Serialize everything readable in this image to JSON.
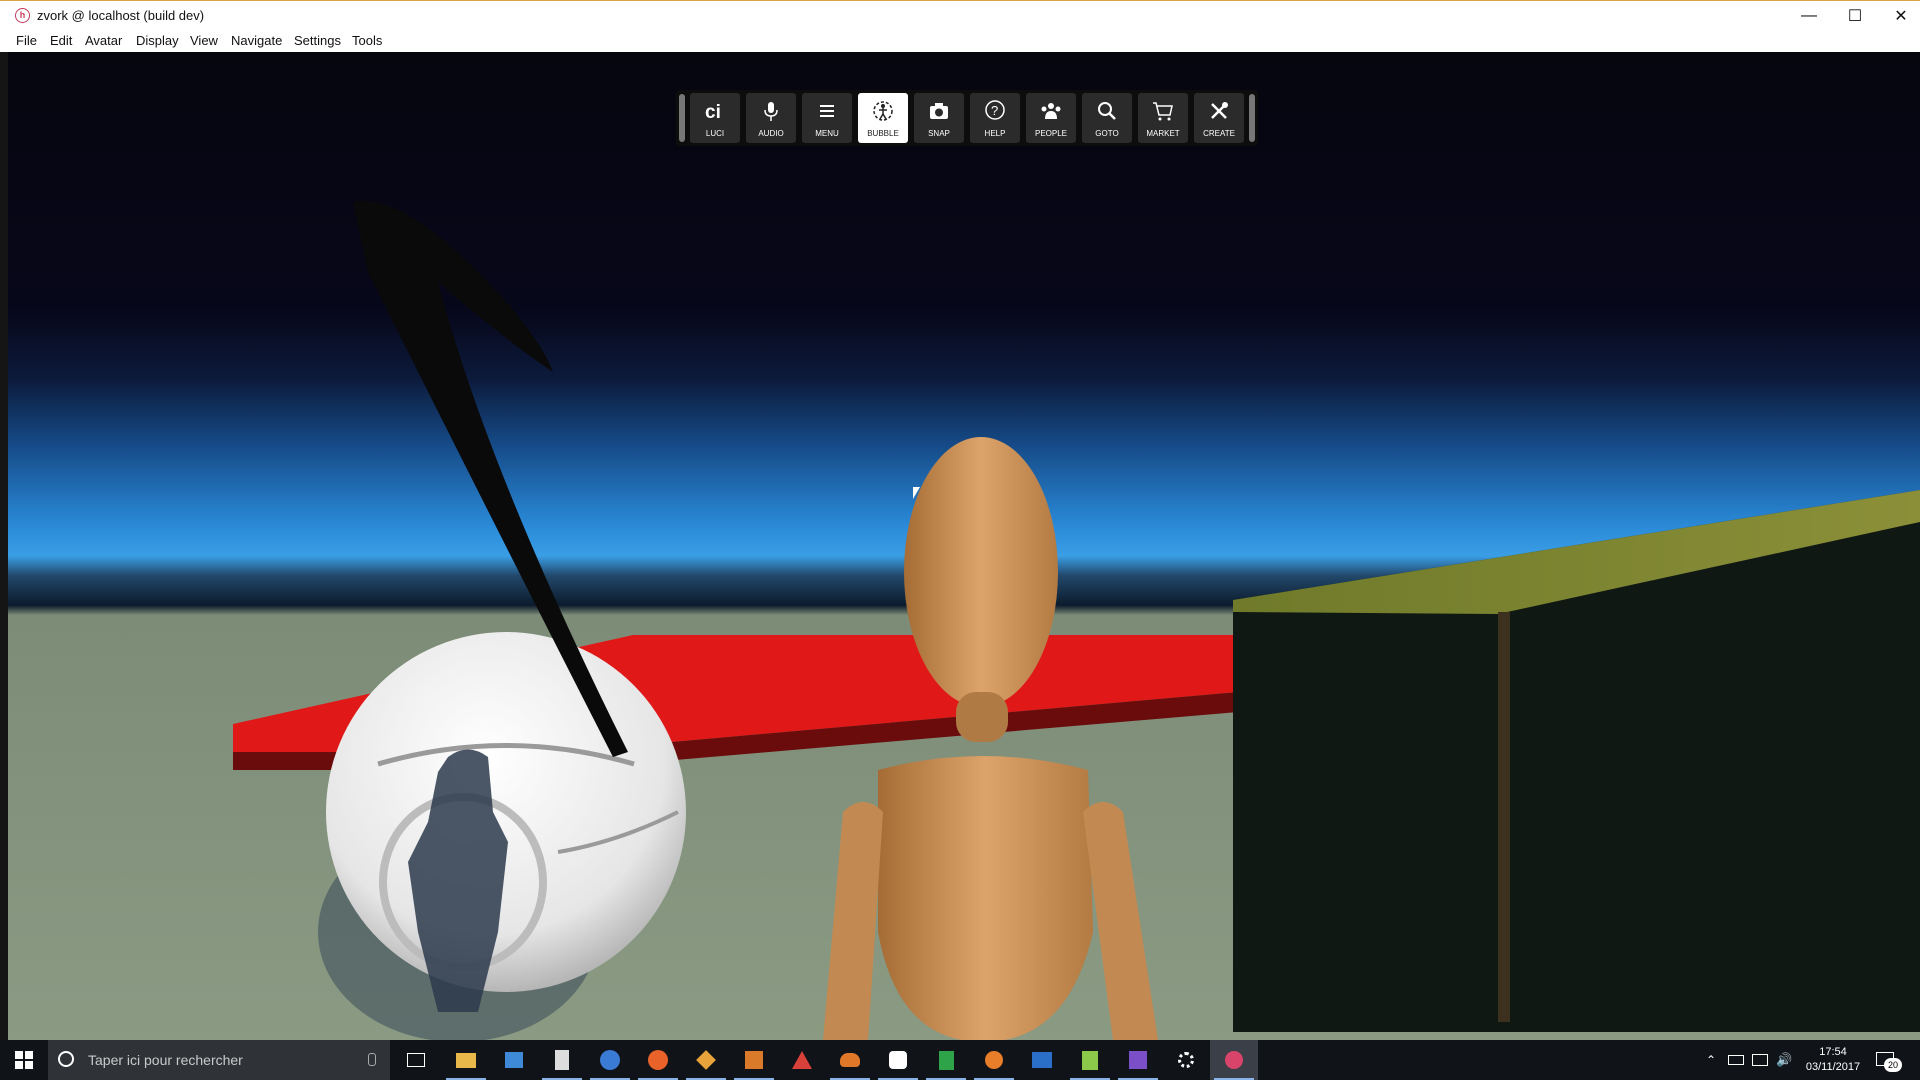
{
  "window": {
    "title": "zvork @ localhost (build dev)"
  },
  "menu": [
    "File",
    "Edit",
    "Avatar",
    "Display",
    "View",
    "Navigate",
    "Settings",
    "Tools"
  ],
  "toolbar": {
    "buttons": [
      {
        "label": "LUCI",
        "icon": "luci-icon",
        "active": false
      },
      {
        "label": "AUDIO",
        "icon": "microphone-icon",
        "active": false
      },
      {
        "label": "MENU",
        "icon": "hamburger-menu-icon",
        "active": false
      },
      {
        "label": "BUBBLE",
        "icon": "bubble-person-icon",
        "active": true
      },
      {
        "label": "SNAP",
        "icon": "camera-icon",
        "active": false
      },
      {
        "label": "HELP",
        "icon": "help-question-icon",
        "active": false
      },
      {
        "label": "PEOPLE",
        "icon": "people-icon",
        "active": false
      },
      {
        "label": "GOTO",
        "icon": "search-magnifier-icon",
        "active": false
      },
      {
        "label": "MARKET",
        "icon": "shopping-cart-icon",
        "active": false
      },
      {
        "label": "CREATE",
        "icon": "tools-icon",
        "active": false
      }
    ]
  },
  "taskbar": {
    "search_placeholder": "Taper ici pour rechercher",
    "time": "17:54",
    "date": "03/11/2017",
    "notification_count": "20",
    "pinned_apps": [
      "file-explorer-icon",
      "store-icon",
      "calculator-icon",
      "edge-like-icon",
      "firefox-icon",
      "git-icon",
      "visual-studio-code-icon",
      "triangle-app-icon",
      "crab-app-icon",
      "slack-icon",
      "spreadsheet-icon",
      "blender-icon",
      "window-app-icon",
      "notepad-icon",
      "visual-studio-icon",
      "settings-gear-icon",
      "interface-app-icon"
    ]
  },
  "colors": {
    "accent": "#8ab4e8",
    "toolbar_bg": "#0d0d0d",
    "taskbar_bg": "#101318"
  }
}
